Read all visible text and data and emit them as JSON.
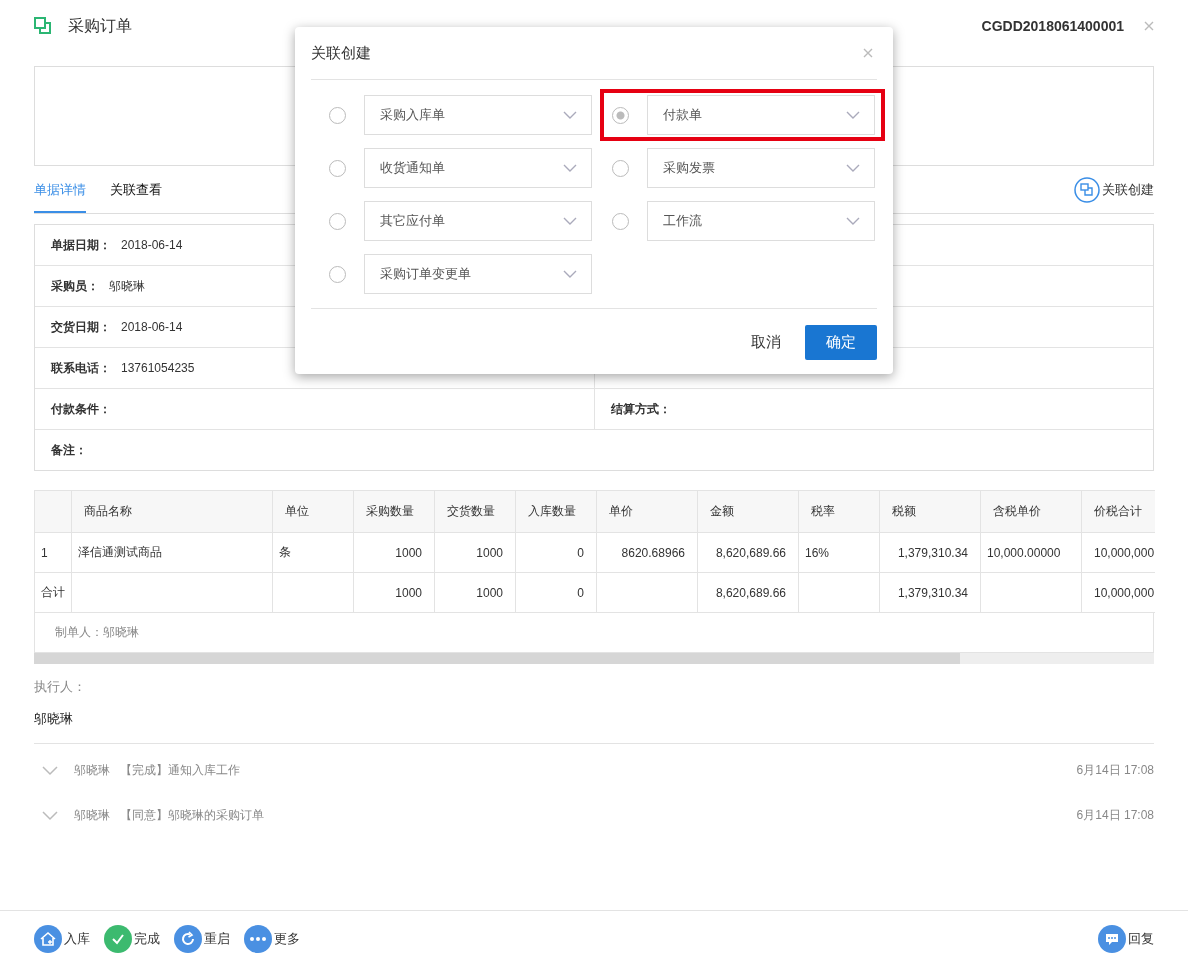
{
  "header": {
    "title": "采购订单",
    "doc_number": "CGDD2018061400001"
  },
  "tabs": [
    {
      "label": "单据详情",
      "selected": true
    },
    {
      "label": "关联查看",
      "selected": false
    }
  ],
  "link_create_button": "关联创建",
  "form": [
    {
      "label": "单据日期：",
      "value": "2018-06-14"
    },
    {
      "label": "采购员：",
      "value": "邬晓琳"
    },
    {
      "label": "交货日期：",
      "value": "2018-06-14"
    },
    {
      "label": "联系电话：",
      "value": "13761054235"
    },
    {
      "label": "付款条件：",
      "right_label": "结算方式："
    },
    {
      "label": "备注：",
      "full": true
    }
  ],
  "table": {
    "columns": [
      "",
      "商品名称",
      "单位",
      "采购数量",
      "交货数量",
      "入库数量",
      "单价",
      "金额",
      "税率",
      "税额",
      "含税单价",
      "价税合计"
    ],
    "rows": [
      [
        "1",
        "泽信通测试商品",
        "条",
        "1000",
        "1000",
        "0",
        "8620.68966",
        "8,620,689.66",
        "16%",
        "1,379,310.34",
        "10,000.00000",
        "10,000,000"
      ],
      [
        "合计",
        "",
        "",
        "1000",
        "1000",
        "0",
        "",
        "8,620,689.66",
        "",
        "1,379,310.34",
        "",
        "10,000,000"
      ]
    ],
    "footer": "制单人：邬晓琳"
  },
  "executor": {
    "label": "执行人：",
    "name": "邬晓琳"
  },
  "log": [
    {
      "user": "邬晓琳",
      "action": "【完成】通知入库工作",
      "time": "6月14日 17:08"
    },
    {
      "user": "邬晓琳",
      "action": "【同意】邬晓琳的采购订单",
      "time": "6月14日 17:08"
    }
  ],
  "actions": [
    {
      "label": "入库",
      "kind": "stock"
    },
    {
      "label": "完成",
      "kind": "done"
    },
    {
      "label": "重启",
      "kind": "restart"
    },
    {
      "label": "更多",
      "kind": "more"
    }
  ],
  "reply_button": "回复",
  "dialog": {
    "title": "关联创建",
    "options": [
      {
        "label": "采购入库单",
        "selected": false,
        "highlighted": false
      },
      {
        "label": "付款单",
        "selected": true,
        "highlighted": true
      },
      {
        "label": "收货通知单",
        "selected": false,
        "highlighted": false
      },
      {
        "label": "采购发票",
        "selected": false,
        "highlighted": false
      },
      {
        "label": "其它应付单",
        "selected": false,
        "highlighted": false
      },
      {
        "label": "工作流",
        "selected": false,
        "highlighted": false
      },
      {
        "label": "采购订单变更单",
        "selected": false,
        "highlighted": false
      }
    ],
    "cancel": "取消",
    "confirm": "确定"
  }
}
